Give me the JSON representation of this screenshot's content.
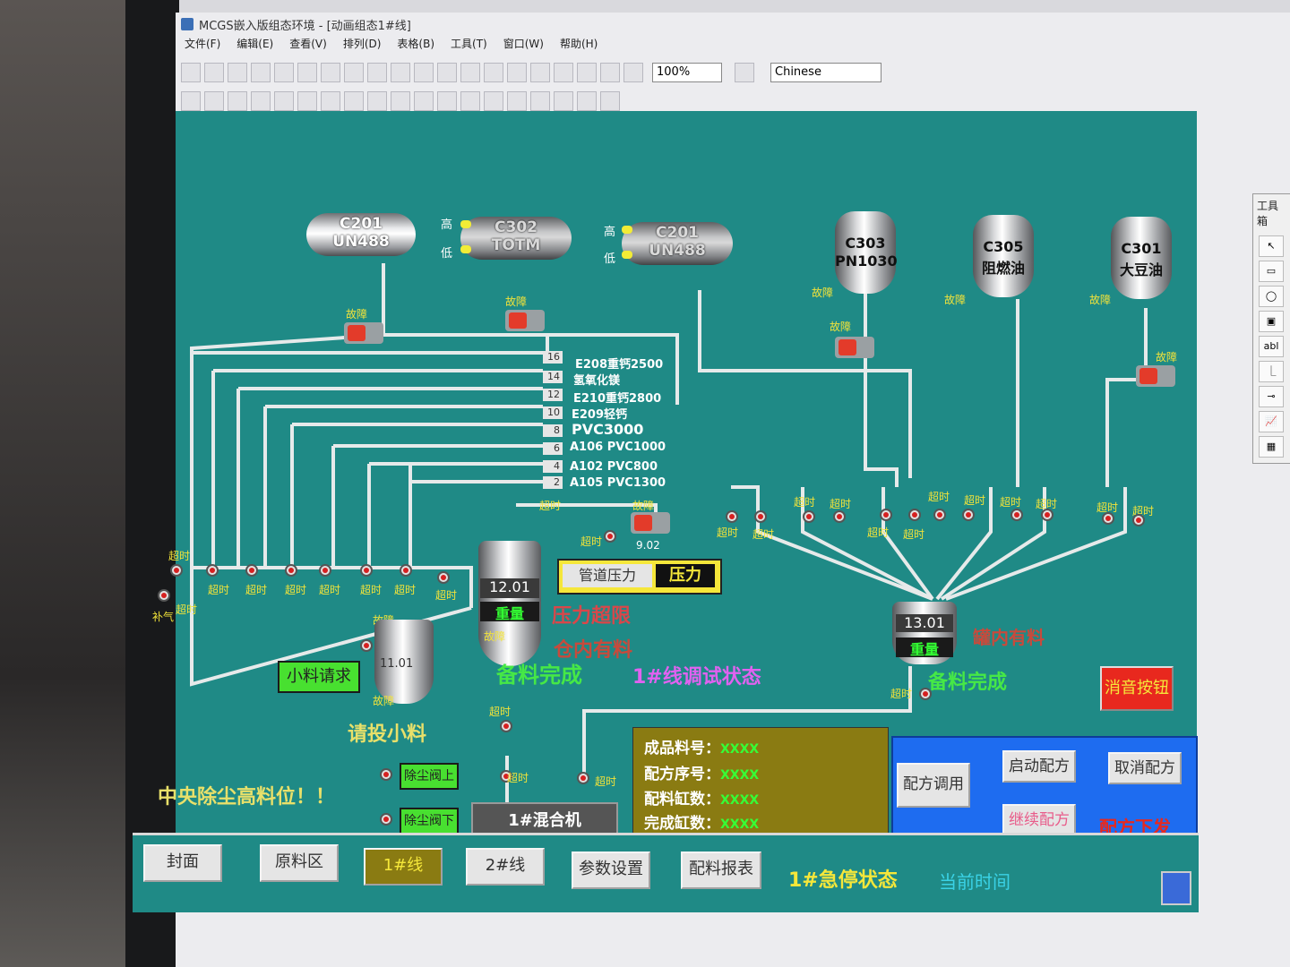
{
  "window": {
    "title": "MCGS嵌入版组态环境 - [动画组态1#线]",
    "menu": [
      "文件(F)",
      "编辑(E)",
      "查看(V)",
      "排列(D)",
      "表格(B)",
      "工具(T)",
      "窗口(W)",
      "帮助(H)"
    ],
    "zoom": "100%",
    "language": "Chinese",
    "toolbox_title": "工具箱",
    "toolbox_items": [
      "↖",
      "▭",
      "◯",
      "▣",
      "abl",
      "⎿",
      "⊸",
      "📈",
      "▦",
      "〽",
      "⌂"
    ]
  },
  "tanks": {
    "t1": {
      "name": "C201",
      "sub": "UN488"
    },
    "t2": {
      "name": "C302",
      "sub": "TOTM",
      "hi": "高",
      "lo": "低"
    },
    "t3": {
      "name": "C201",
      "sub": "UN488",
      "hi": "高",
      "lo": "低"
    },
    "t4": {
      "name": "C303",
      "sub": "PN1030"
    },
    "t5": {
      "name": "C305",
      "sub": "阻燃油"
    },
    "t6": {
      "name": "C301",
      "sub": "大豆油"
    }
  },
  "fault": "故障",
  "timeout": "超时",
  "bugas": "补气",
  "materials": [
    {
      "num": "16",
      "name": "E208重钙2500"
    },
    {
      "num": "14",
      "name": "氢氧化镁"
    },
    {
      "num": "12",
      "name": "E210重钙2800"
    },
    {
      "num": "10",
      "name": "E209轻钙"
    },
    {
      "num": "8",
      "name": "PVC3000"
    },
    {
      "num": "6",
      "name": "A106 PVC1000"
    },
    {
      "num": "4",
      "name": "A102 PVC800"
    },
    {
      "num": "2",
      "name": "A105 PVC1300"
    }
  ],
  "pump_value": "9.02",
  "scale1": {
    "value": "12.01",
    "label": "重量"
  },
  "scale2": {
    "value": "13.01",
    "label": "重量"
  },
  "scale3": {
    "value": "11.01"
  },
  "pressure": {
    "label": "管道压力",
    "value": "压力"
  },
  "status": {
    "pressure_limit": "压力超限",
    "bin_material": "仓内有料",
    "ready1": "备料完成",
    "line_debug": "1#线调试状态",
    "tank_material": "罐内有料",
    "ready2": "备料完成",
    "small_request": "小料请求",
    "feed_small": "请投小料",
    "dust_high": "中央除尘高料位！！",
    "recipe_dispatch": "配方下发",
    "estop": "1#急停状态",
    "current_time": "当前时间"
  },
  "dust_valves": {
    "up": "除尘阀上",
    "down": "除尘阀下"
  },
  "mixer": "1#混合机",
  "info": {
    "product_no": {
      "label": "成品料号：",
      "value": "XXXX"
    },
    "recipe_seq": {
      "label": "配方序号：",
      "value": "XXXX"
    },
    "batch_cnt": {
      "label": "配料缸数：",
      "value": "XXXX"
    },
    "done_cnt": {
      "label": "完成缸数：",
      "value": "XXXX"
    }
  },
  "buttons": {
    "mute": "消音按钮",
    "recipe_call": "配方调用",
    "start_recipe": "启动配方",
    "cancel_recipe": "取消配方",
    "continue_recipe": "继续配方"
  },
  "nav": [
    "封面",
    "原料区",
    "1#线",
    "2#线",
    "参数设置",
    "配料报表"
  ],
  "colors": {
    "background": "#1f8a86",
    "active_nav": "#8a7b12",
    "alarm": "#e8281e"
  }
}
